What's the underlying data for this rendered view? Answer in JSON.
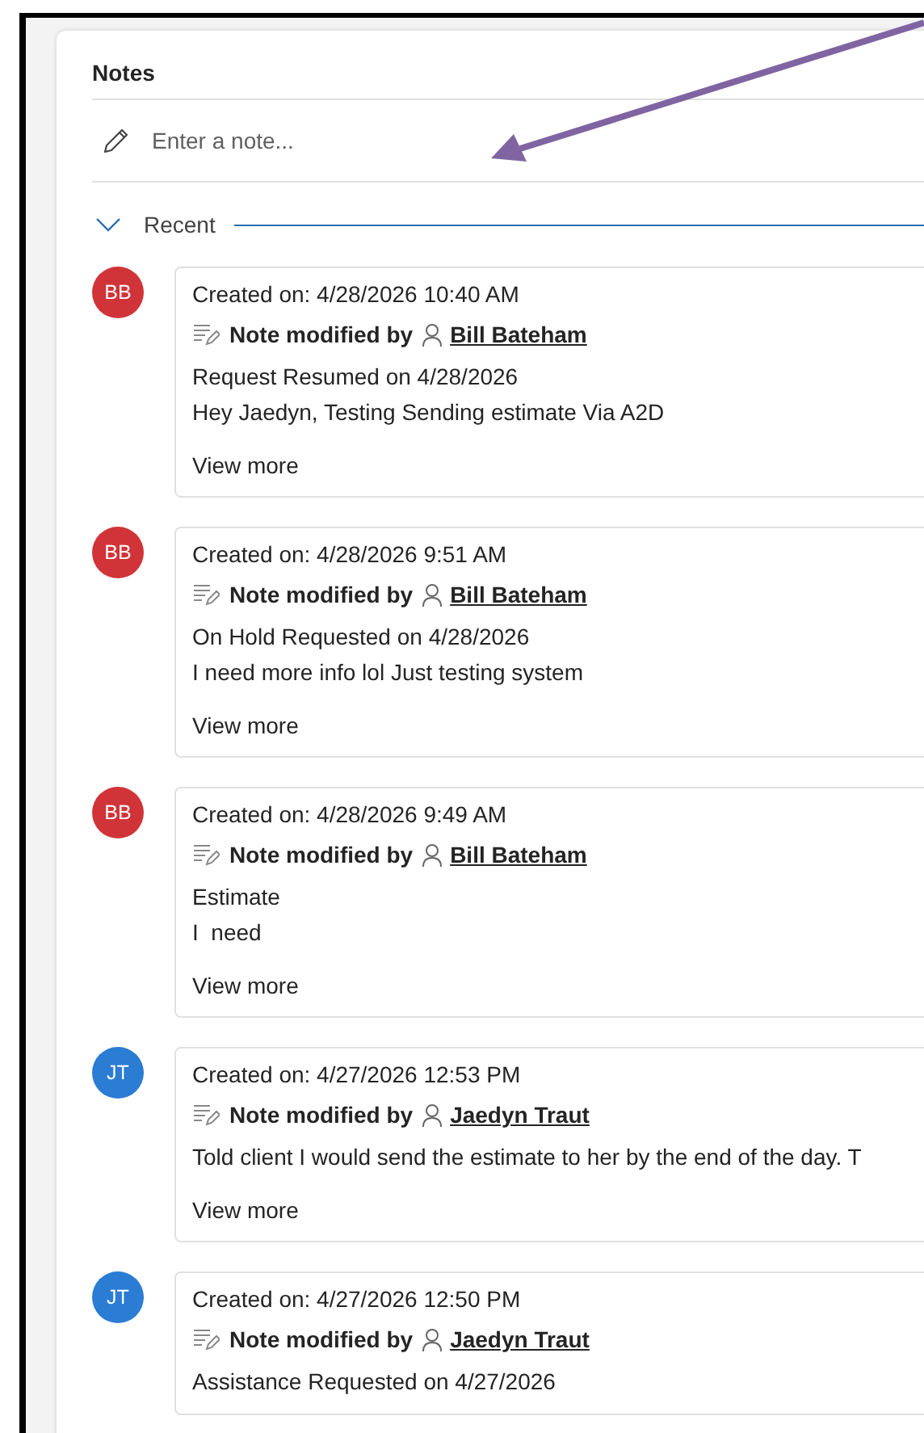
{
  "notes": {
    "title": "Notes",
    "input": {
      "placeholder": "Enter a note..."
    },
    "section": {
      "label": "Recent",
      "expanded": true
    },
    "entries": [
      {
        "initials": "BB",
        "color": "#d13438",
        "created": "Created on: 4/28/2026 10:40 AM",
        "modified_label": "Note modified by",
        "author": "Bill Bateham",
        "body": [
          "Request Resumed on 4/28/2026",
          "Hey Jaedyn, Testing Sending estimate Via A2D"
        ],
        "view_more": "View more"
      },
      {
        "initials": "BB",
        "color": "#d13438",
        "created": "Created on: 4/28/2026 9:51 AM",
        "modified_label": "Note modified by",
        "author": "Bill Bateham",
        "body": [
          "On Hold Requested on 4/28/2026",
          "I need more info lol Just testing system"
        ],
        "view_more": "View more"
      },
      {
        "initials": "BB",
        "color": "#d13438",
        "created": "Created on: 4/28/2026 9:49 AM",
        "modified_label": "Note modified by",
        "author": "Bill Bateham",
        "body": [
          "Estimate",
          "I  need"
        ],
        "view_more": "View more"
      },
      {
        "initials": "JT",
        "color": "#2b7cd3",
        "created": "Created on: 4/27/2026 12:53 PM",
        "modified_label": "Note modified by",
        "author": "Jaedyn Traut",
        "body": [
          "Told client I would send the estimate to her by the end of the day. T"
        ],
        "view_more": "View more"
      },
      {
        "initials": "JT",
        "color": "#2b7cd3",
        "created": "Created on: 4/27/2026 12:50 PM",
        "modified_label": "Note modified by",
        "author": "Jaedyn Traut",
        "body": [
          "Assistance Requested on 4/27/2026"
        ]
      }
    ]
  }
}
